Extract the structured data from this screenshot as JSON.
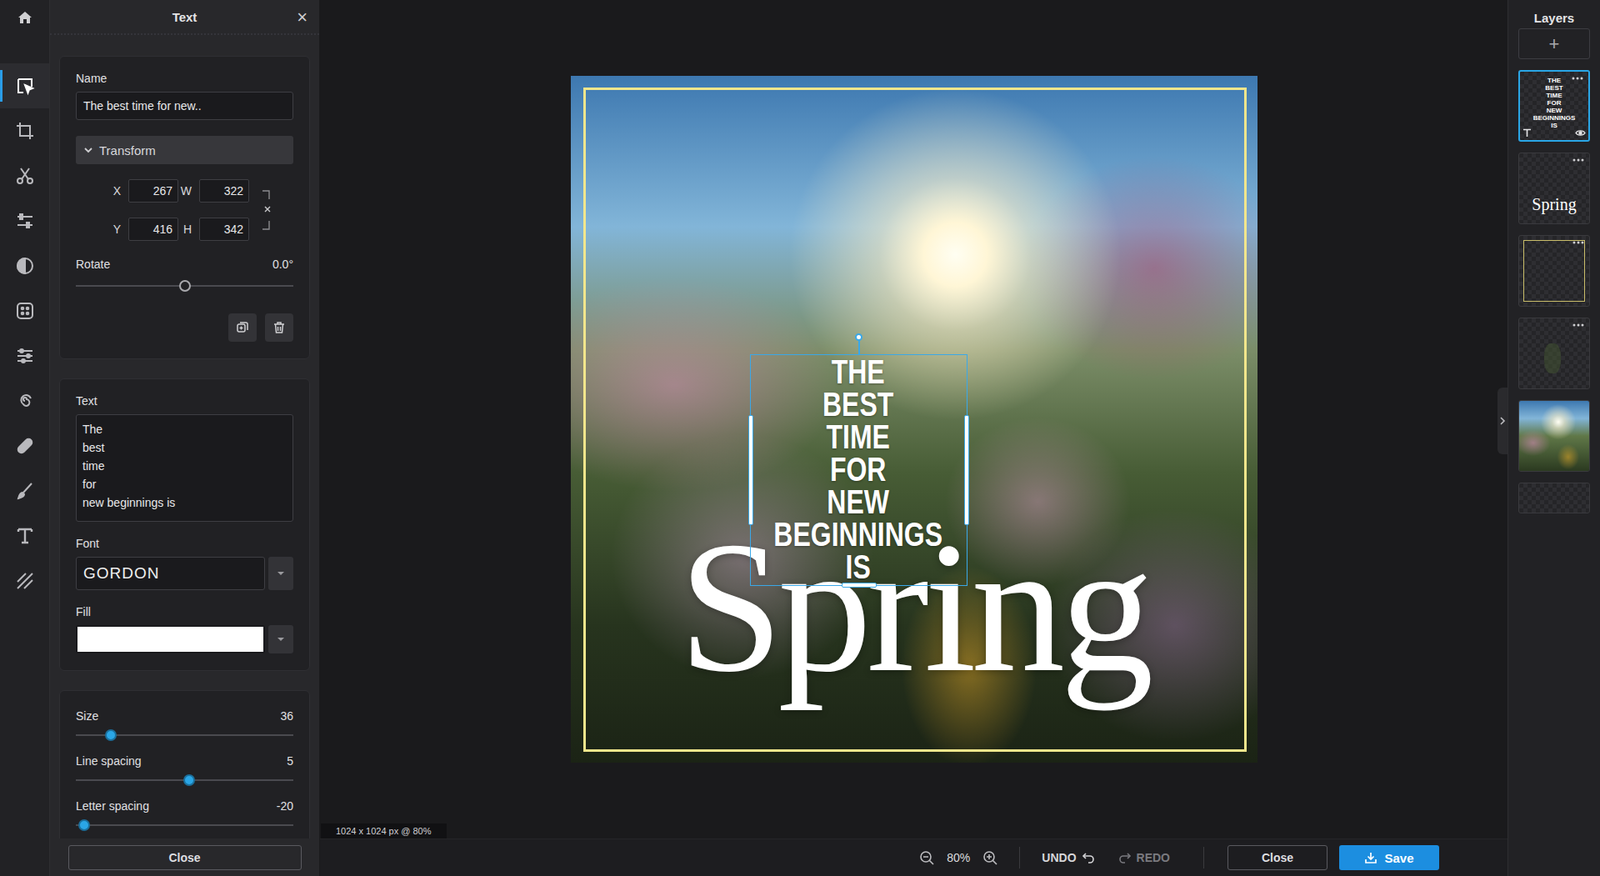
{
  "panel": {
    "title": "Text",
    "close": "×",
    "footer_button": "Close"
  },
  "tools": [
    {
      "selected": true
    },
    {
      "selected": false
    },
    {
      "selected": false
    },
    {
      "selected": false
    },
    {
      "selected": false
    },
    {
      "selected": false
    },
    {
      "selected": false
    },
    {
      "selected": false
    },
    {
      "selected": false
    },
    {
      "selected": false
    },
    {
      "selected": false
    },
    {
      "selected": false
    }
  ],
  "name": {
    "label": "Name",
    "value": "The best time for new.."
  },
  "transform": {
    "label": "Transform",
    "expanded": true,
    "rows": [
      [
        {
          "label": "X",
          "value": "267"
        },
        {
          "label": "W",
          "value": "322"
        }
      ],
      [
        {
          "label": "Y",
          "value": "416"
        },
        {
          "label": "H",
          "value": "342"
        }
      ]
    ],
    "rotate": {
      "label": "Rotate",
      "reading": "0.0°",
      "level": 0.5
    }
  },
  "text": {
    "label": "Text",
    "lines": [
      "The",
      "best",
      "time",
      "for",
      "new beginnings is"
    ]
  },
  "font": {
    "label": "Font",
    "value": "GORDON"
  },
  "fill": {
    "label": "Fill",
    "color": "#ffffff"
  },
  "sliders": [
    {
      "label": "Size",
      "reading": "36",
      "level": 0.16
    },
    {
      "label": "Line spacing",
      "reading": "5",
      "level": 0.52
    },
    {
      "label": "Letter spacing",
      "reading": "-20",
      "level": 0.04
    }
  ],
  "canvas": {
    "info": "1024 x 1024 px @ 80%",
    "headline": [
      "THE",
      "BEST",
      "TIME",
      "FOR",
      "NEW",
      "BEGINNINGS",
      "IS"
    ],
    "title": "Spring"
  },
  "bottom_bar": {
    "zoom": "80%",
    "undo": {
      "label": "UNDO",
      "disabled": false
    },
    "redo": {
      "label": "REDO",
      "disabled": true
    },
    "close": "Close",
    "save": "Save"
  },
  "layers": {
    "title": "Layers",
    "add": "+",
    "items": [
      {
        "kind": "text",
        "preview": [
          "THE",
          "BEST",
          "TIME",
          "FOR",
          "NEW",
          "BEGINNINGS",
          "IS"
        ],
        "selected": true
      },
      {
        "kind": "text",
        "preview": [
          "Spring"
        ],
        "selected": false
      },
      {
        "kind": "frame",
        "preview": [],
        "selected": false
      },
      {
        "kind": "shape",
        "preview": [],
        "selected": false
      },
      {
        "kind": "image",
        "preview": [],
        "selected": false
      },
      {
        "kind": "empty",
        "preview": [],
        "selected": false
      }
    ]
  }
}
